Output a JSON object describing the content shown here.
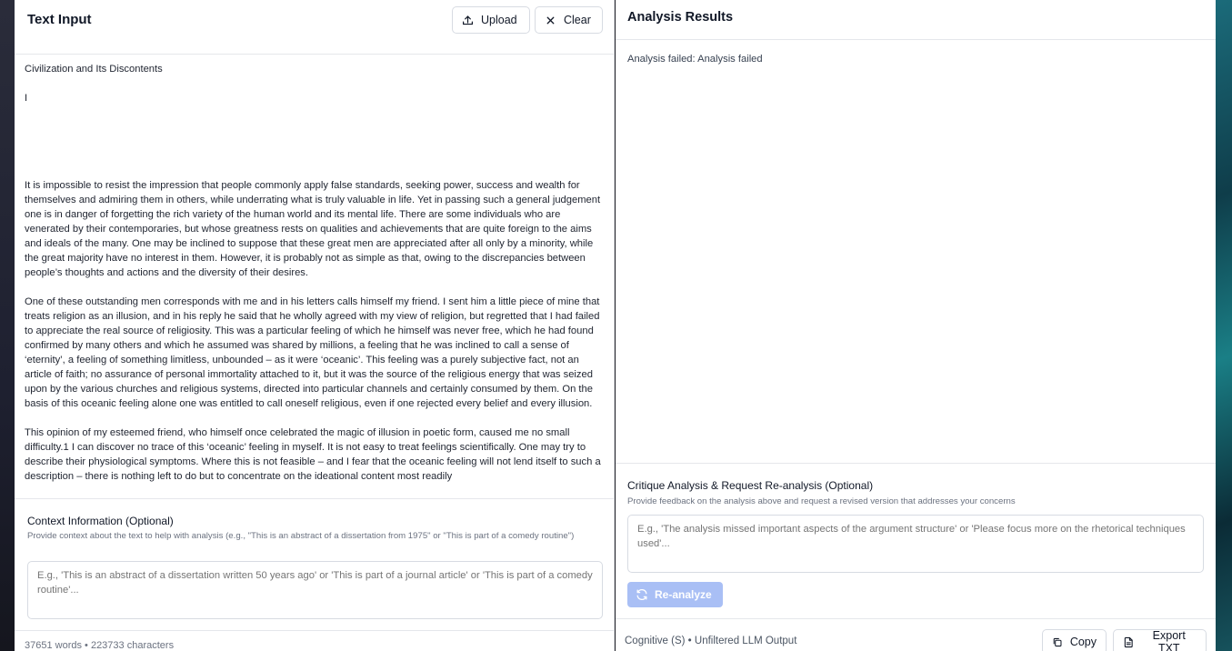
{
  "left_panel": {
    "title": "Text Input",
    "upload_label": "Upload",
    "clear_label": "Clear",
    "text": {
      "title": "Civilization and Its Discontents",
      "numeral": "I",
      "paragraphs": [
        "It is impossible to resist the impression that people commonly apply false standards, seeking power, success and wealth for themselves and admiring them in others, while underrating what is truly valuable in life. Yet in passing such a general judgement one is in danger of forgetting the rich variety of the human world and its mental life. There are some individuals who are venerated by their contemporaries, but whose greatness rests on qualities and achievements that are quite foreign to the aims and ideals of the many. One may be inclined to suppose that these great men are appreciated after all only by a minority, while the great majority have no interest in them. However, it is probably not as simple as that, owing to the discrepancies between people’s thoughts and actions and the diversity of their desires.",
        "One of these outstanding men corresponds with me and in his letters calls himself my friend. I sent him a little piece of mine that treats religion as an illusion, and in his reply he said that he wholly agreed with my view of religion, but regretted that I had failed to appreciate the real source of religiosity. This was a particular feeling of which he himself was never free, which he had found confirmed by many others and which he assumed was shared by millions, a feeling that he was inclined to call a sense of ‘eternity’, a feeling of something limitless, unbounded – as it were ‘oceanic’. This feeling was a purely subjective fact, not an article of faith; no assurance of personal immortality attached to it, but it was the source of the religious energy that was seized upon by the various churches and religious systems, directed into particular channels and certainly consumed by them. On the basis of this oceanic feeling alone one was entitled to call oneself religious, even if one rejected every belief and every illusion.",
        "This opinion of my esteemed friend, who himself once celebrated the magic of illusion in poetic form, caused me no small difficulty.1 I can discover no trace of this ‘oceanic’ feeling in myself. It is not easy to treat feelings scientifically. One may try to describe their physiological symptoms. Where this is not feasible – and I fear that the oceanic feeling will not lend itself to such a description – there is nothing left to do but to concentrate on the ideational content most readily"
      ]
    },
    "context": {
      "title": "Context Information (Optional)",
      "description": "Provide context about the text to help with analysis (e.g., \"This is an abstract of a dissertation from 1975\" or \"This is part of a comedy routine\")",
      "placeholder": "E.g., 'This is an abstract of a dissertation written 50 years ago' or 'This is part of a journal article' or 'This is part of a comedy routine'..."
    },
    "stats": "37651 words • 223733 characters"
  },
  "right_panel": {
    "title": "Analysis Results",
    "result_text": "Analysis failed: Analysis failed",
    "critique": {
      "title": "Critique Analysis & Request Re-analysis (Optional)",
      "description": "Provide feedback on the analysis above and request a revised version that addresses your concerns",
      "placeholder": "E.g., 'The analysis missed important aspects of the argument structure' or 'Please focus more on the rhetorical techniques used'...",
      "reanalyze_label": "Re-analyze"
    },
    "footer": {
      "status": "Cognitive (S) • Unfiltered LLM Output",
      "copy_label": "Copy",
      "export_label": "Export TXT"
    }
  },
  "icons": {
    "upload": "upload-icon",
    "clear": "close-icon",
    "reanalyze": "refresh-icon",
    "copy": "copy-icon",
    "export": "file-text-icon"
  },
  "colors": {
    "reanalyze_button_bg": "#a9bff5",
    "border": "#e5e7eb"
  }
}
